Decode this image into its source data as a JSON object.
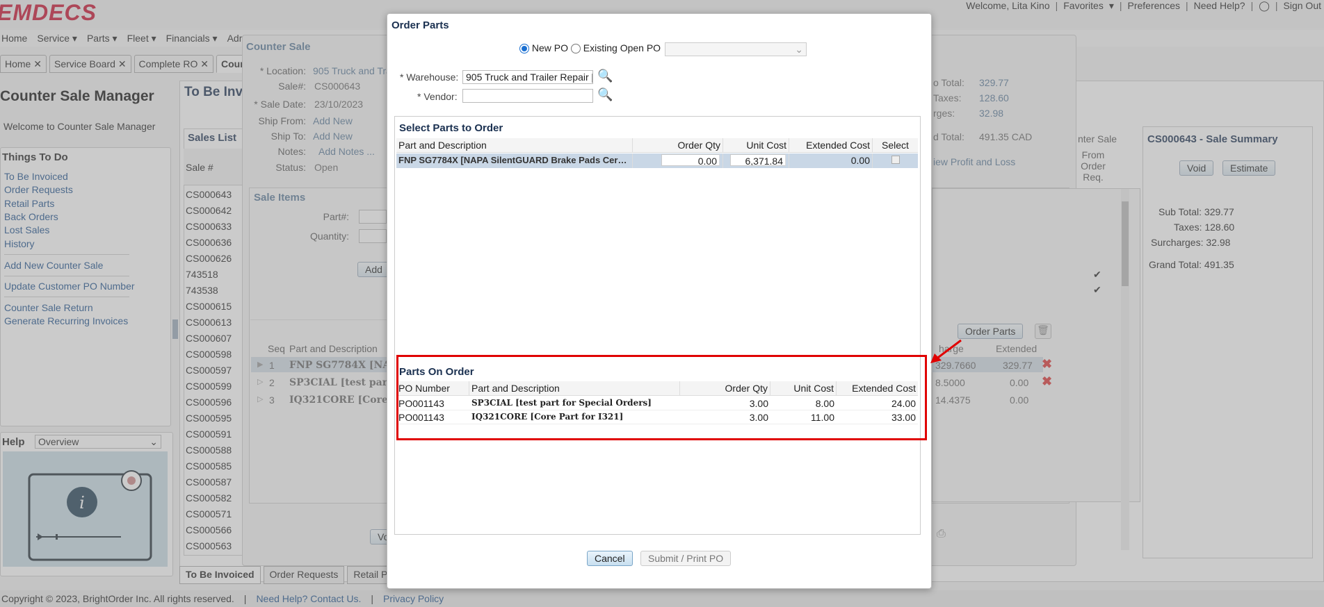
{
  "header": {
    "logo": "EMDECS",
    "welcome": "Welcome, Lita Kino",
    "links": [
      "Favorites",
      "Preferences",
      "Need Help?",
      "Sign Out"
    ]
  },
  "nav": {
    "items": [
      "Home",
      "Service",
      "Parts",
      "Fleet",
      "Financials",
      "Adm"
    ]
  },
  "tabs": {
    "items": [
      "Home",
      "Service Board",
      "Complete RO",
      "Coun"
    ]
  },
  "left": {
    "page_title": "Counter Sale Manager",
    "welcome": "Welcome to Counter Sale Manager",
    "things_to_do": "Things To Do",
    "links_group1": [
      "To Be Invoiced",
      "Order Requests",
      "Retail Parts",
      "Back Orders",
      "Lost Sales",
      "History"
    ],
    "link_add": "Add New Counter Sale",
    "link_update": "Update Customer PO Number",
    "link_return": "Counter Sale Return",
    "link_recurring": "Generate Recurring Invoices",
    "help_title": "Help",
    "help_select": "Overview"
  },
  "tbi": {
    "title": "To Be Invo",
    "sales_list_title": "Sales List",
    "sale_col": "Sale #",
    "sales": [
      "CS000643",
      "CS000642",
      "CS000633",
      "CS000636",
      "CS000626",
      "743518",
      "743538",
      "CS000615",
      "CS000613",
      "CS000607",
      "CS000598",
      "CS000597",
      "CS000599",
      "CS000596",
      "CS000595",
      "CS000591",
      "CS000588",
      "CS000585",
      "CS000587",
      "CS000582",
      "CS000571",
      "CS000566",
      "CS000563"
    ],
    "bottom_tabs": [
      "To Be Invoiced",
      "Order Requests",
      "Retail Pa"
    ]
  },
  "counter_sale": {
    "title": "Counter Sale",
    "location_label": "* Location:",
    "location_value": "905 Truck and Tra",
    "sale_label": "Sale#:",
    "sale_value": "CS000643",
    "date_label": "* Sale Date:",
    "date_value": "23/10/2023",
    "shipfrom_label": "Ship From:",
    "shipfrom_value": "Add New",
    "shipto_label": "Ship To:",
    "shipto_value": "Add New",
    "notes_label": "Notes:",
    "notes_value": "Add Notes ...",
    "status_label": "Status:",
    "status_value": "Open",
    "sale_items_title": "Sale Items",
    "partnum_label": "Part#:",
    "quantity_label": "Quantity:",
    "add_button": "Add",
    "seq_col": "Seq",
    "part_col": "Part and Description",
    "items": [
      {
        "seq": "1",
        "part": "FNP SG7784X [NAPA S"
      },
      {
        "seq": "2",
        "part": "SP3CIAL [test part for"
      },
      {
        "seq": "3",
        "part": "IQ321CORE [Core Part"
      }
    ],
    "totals": [
      {
        "label": "o Total:",
        "value": "329.77"
      },
      {
        "label": "Taxes:",
        "value": "128.60"
      },
      {
        "label": "rges:",
        "value": "32.98"
      },
      {
        "label": "d Total:",
        "value": "491.35 CAD"
      }
    ],
    "profit_link": "iew Profit and Loss",
    "counter_sale_col": "nter Sale",
    "from_order_req": "From Order Req.",
    "order_parts_button": "Order Parts",
    "charge_col": "harge",
    "extended_col": "Extended",
    "charges": [
      "329.7660",
      "8.5000",
      "14.4375"
    ],
    "extendeds": [
      "329.77",
      "0.00",
      "0.00"
    ],
    "void_button": "Vo"
  },
  "summary": {
    "title": "CS000643 - Sale Summary",
    "void": "Void",
    "estimate": "Estimate",
    "sub_total_label": "Sub Total:",
    "sub_total": "329.77",
    "taxes_label": "Taxes:",
    "taxes": "128.60",
    "surcharges_label": "Surcharges:",
    "surcharges": "32.98",
    "grand_total_label": "Grand Total:",
    "grand_total": "491.35"
  },
  "modal": {
    "title": "Order Parts",
    "new_po": "New PO",
    "existing_po": "Existing Open PO",
    "warehouse_label": "* Warehouse:",
    "warehouse_value": "905 Truck and Trailer Repair [",
    "vendor_label": "* Vendor:",
    "vendor_value": "",
    "select_title": "Select Parts to Order",
    "select_cols": [
      "Part and Description",
      "Order Qty",
      "Unit Cost",
      "Extended Cost",
      "Select"
    ],
    "select_rows": [
      {
        "part": "FNP SG7784X [NAPA SilentGUARD Brake Pads Cera...",
        "qty": "0.00",
        "unit": "6,371.84",
        "ext": "0.00"
      }
    ],
    "on_order_title": "Parts On Order",
    "on_order_cols": [
      "PO Number",
      "Part and Description",
      "Order Qty",
      "Unit Cost",
      "Extended Cost"
    ],
    "on_order_rows": [
      {
        "po": "PO001143",
        "part": "SP3CIAL [test part for Special Orders]",
        "qty": "3.00",
        "unit": "8.00",
        "ext": "24.00"
      },
      {
        "po": "PO001143",
        "part": "IQ321CORE [Core Part for I321]",
        "qty": "3.00",
        "unit": "11.00",
        "ext": "33.00"
      }
    ],
    "cancel": "Cancel",
    "submit": "Submit / Print PO"
  },
  "footer": {
    "copyright": "Copyright © 2023, BrightOrder Inc. All rights reserved.",
    "help_link": "Need Help? Contact Us.",
    "privacy_link": "Privacy Policy"
  },
  "colors": {
    "brand": "#c8102e",
    "link": "#1a4f8c",
    "highlight": "#e00000"
  }
}
